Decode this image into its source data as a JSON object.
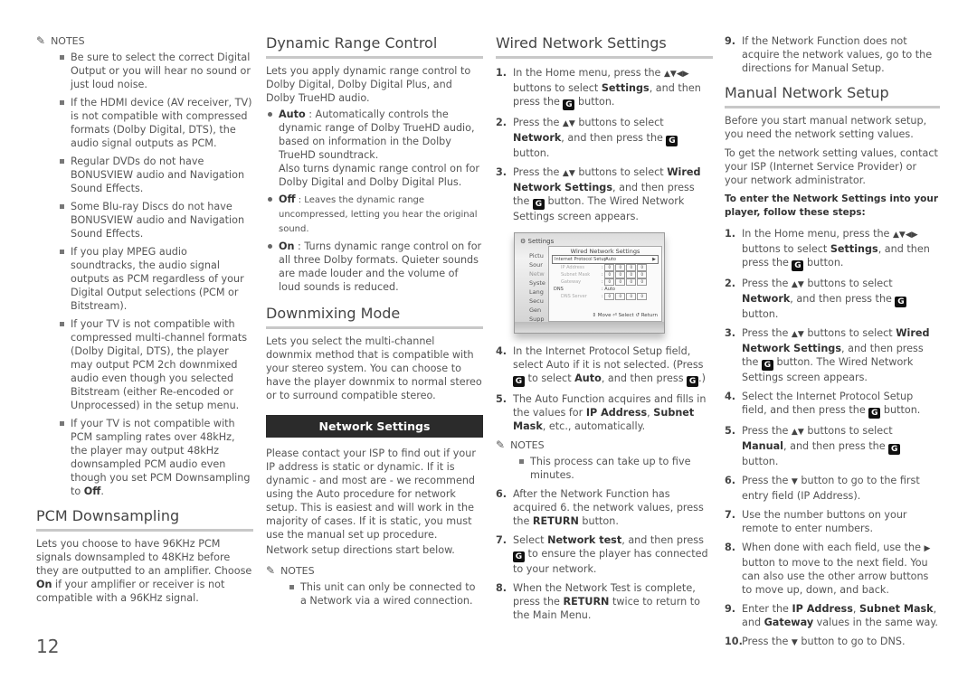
{
  "page_number": "12",
  "col1": {
    "notes_label": "NOTES",
    "notes": [
      "Be sure to select the correct Digital Output or you will hear no sound or just loud noise.",
      "If the HDMI device (AV receiver, TV) is not compatible with compressed formats (Dolby Digital, DTS), the audio signal outputs as PCM.",
      "Regular DVDs do not have BONUSVIEW audio and Navigation Sound Effects.",
      "Some Blu-ray Discs do not have BONUSVIEW audio and Navigation Sound Effects.",
      "If you play MPEG audio soundtracks, the audio signal outputs as PCM regardless of your Digital Output selections (PCM or Bitstream).",
      "If your TV is not compatible with compressed multi-channel formats (Dolby Digital, DTS), the player may output PCM 2ch downmixed audio even though you selected Bitstream (either Re-encoded or Unprocessed) in the setup menu."
    ],
    "note_last_pre": "If your TV is not compatible with PCM sampling rates over 48kHz, the player may output 48kHz downsampled PCM audio even though you set PCM Downsampling to ",
    "note_last_bold": "Off",
    "note_last_post": ".",
    "pcm_title": "PCM Downsampling",
    "pcm_body_pre": "Lets you choose to have 96KHz PCM signals downsampled to 48KHz before they are outputted to an amplifier. Choose ",
    "pcm_body_bold": "On",
    "pcm_body_post": " if your amplifier or receiver is not compatible with a 96KHz signal."
  },
  "col2": {
    "drc_title": "Dynamic Range Control",
    "drc_body": "Lets you apply dynamic range control to Dolby Digital, Dolby Digital Plus, and Dolby TrueHD audio.",
    "drc_options": [
      {
        "name": "Auto",
        "text": " : Automatically controls the dynamic range of Dolby TrueHD audio, based on information in the Dolby TrueHD soundtrack.",
        "extra": "Also turns dynamic range control on for Dolby Digital and Dolby Digital Plus."
      },
      {
        "name": "Off",
        "text": " : Leaves the dynamic range uncompressed, letting you hear the original sound.",
        "extra": ""
      },
      {
        "name": "On",
        "text": " : Turns dynamic range control on for all three Dolby formats. Quieter sounds are made louder and the volume of loud sounds is reduced.",
        "extra": ""
      }
    ],
    "downmix_title": "Downmixing Mode",
    "downmix_body": "Lets you select the multi-channel downmix method that is compatible with your stereo system. You can choose to have the player downmix to normal stereo or to surround compatible stereo.",
    "banner": "Network Settings",
    "network_body": "Please contact your ISP to find out if your IP address is static or dynamic. If it is dynamic - and most are - we recommend using the Auto procedure for network setup. This is easiest and will work in the majority of cases. If it is static, you must use the manual set up procedure.",
    "network_body2": "Network setup directions start below.",
    "notes_label": "NOTES",
    "notes": [
      "This unit can only be connected to a Network via a wired connection."
    ]
  },
  "col3": {
    "title": "Wired Network Settings",
    "step1": {
      "n": "1.",
      "a": "In the Home menu, press the ",
      "arrows": "▲▼◀▶",
      "b": " buttons to select ",
      "bold": "Settings",
      "c": ", and then press the ",
      "d": " button."
    },
    "step2": {
      "n": "2.",
      "a": "Press the ",
      "arrows": "▲▼",
      "b": " buttons to select ",
      "bold": "Network",
      "c": ", and then press the ",
      "d": " button."
    },
    "step3": {
      "n": "3.",
      "a": "Press the ",
      "arrows": "▲▼",
      "b": " buttons to select ",
      "bold": "Wired Network Settings",
      "c": ", and then press the ",
      "d": " button. The Wired Network Settings screen appears."
    },
    "screenshot": {
      "title": "Settings",
      "menu": [
        "Pictu",
        "Sour",
        "Netw",
        "Syste",
        "Lang",
        "Secu",
        "Gen",
        "Supp"
      ],
      "dialog_title": "Wired Network Settings",
      "ips_label": "Internet Protocol Setup",
      "ips_value": ": Auto",
      "ip_label": "IP Address",
      "mask_label": "Subnet Mask",
      "gw_label": "Gateway",
      "dns_label": "DNS",
      "dns_value": ": Auto",
      "dns_server_label": "DNS Server",
      "box_value": "0",
      "footer": "⇕ Move  ⏎ Select  ↺ Return"
    },
    "step4": {
      "n": "4.",
      "a": "In the Internet Protocol Setup field, select Auto if it is not selected. (Press ",
      "b": " to select ",
      "bold": "Auto",
      "c": ", and then press ",
      "d": ".)"
    },
    "step5": {
      "n": "5.",
      "a": "The Auto Function acquires and fills in the values for ",
      "bold1": "IP Address",
      "sep": ", ",
      "bold2": "Subnet Mask",
      "c": ", etc., automatically."
    },
    "notes_label": "NOTES",
    "notes": [
      "This process can take up to five minutes."
    ],
    "step6": {
      "n": "6.",
      "a": "After the Network Function has acquired 6. the network values, press the ",
      "bold": "RETURN",
      "c": " button."
    },
    "step7": {
      "n": "7.",
      "a": "Select ",
      "bold": "Network test",
      "b": ", and then press ",
      "c": " to ensure the player has connected to your network."
    },
    "step8": {
      "n": "8.",
      "a": "When the Network Test is complete, press the ",
      "bold": "RETURN",
      "c": " twice to return to the Main Menu."
    }
  },
  "col4": {
    "step9": {
      "n": "9.",
      "text": "If the Network Function does not acquire the network values, go to the directions for Manual Setup."
    },
    "title": "Manual Network Setup",
    "intro1": "Before you start manual network setup, you need the network setting values.",
    "intro2": "To get the network setting values, contact your ISP (Internet Service Provider) or your network administrator.",
    "intro3": "To enter the Network Settings into your player, follow these steps:",
    "step1": {
      "n": "1.",
      "a": "In the Home menu, press the ",
      "arrows": "▲▼◀▶",
      "b": " buttons to select ",
      "bold": "Settings",
      "c": ", and then press the ",
      "d": " button."
    },
    "step2": {
      "n": "2.",
      "a": "Press the ",
      "arrows": "▲▼",
      "b": " buttons to select ",
      "bold": "Network",
      "c": ", and then press the ",
      "d": " button."
    },
    "step3": {
      "n": "3.",
      "a": "Press the ",
      "arrows": "▲▼",
      "b": " buttons to select ",
      "bold": "Wired Network Settings",
      "c": ", and then press the ",
      "d": " button. The Wired Network Settings screen appears."
    },
    "step4": {
      "n": "4.",
      "a": "Select the Internet Protocol Setup field, and then press the ",
      "d": " button."
    },
    "step5": {
      "n": "5.",
      "a": "Press the ",
      "arrows": "▲▼",
      "b": " buttons to select ",
      "bold": "Manual",
      "c": ", and then press the ",
      "d": " button."
    },
    "step6": {
      "n": "6.",
      "a": "Press the ",
      "arrows": "▼",
      "b": " button to go to the first entry field (IP Address)."
    },
    "step7": {
      "n": "7.",
      "text": "Use the number buttons on your remote to enter numbers."
    },
    "step8": {
      "n": "8.",
      "a": "When done with each field, use the ",
      "arrows": "▶",
      "b": " button to move to the next field. You can also use the other arrow buttons to move up, down, and back."
    },
    "step9b": {
      "n": "9.",
      "a": "Enter the ",
      "bold1": "IP Address",
      "sep": ", ",
      "bold2": "Subnet Mask",
      "b": ", and ",
      "bold3": "Gateway",
      "c": " values in the same way."
    },
    "step10": {
      "n": "10.",
      "a": "Press the ",
      "arrows": "▼",
      "b": " button to go to DNS."
    }
  },
  "icons": {
    "enter": "G",
    "pencil": "✎"
  }
}
